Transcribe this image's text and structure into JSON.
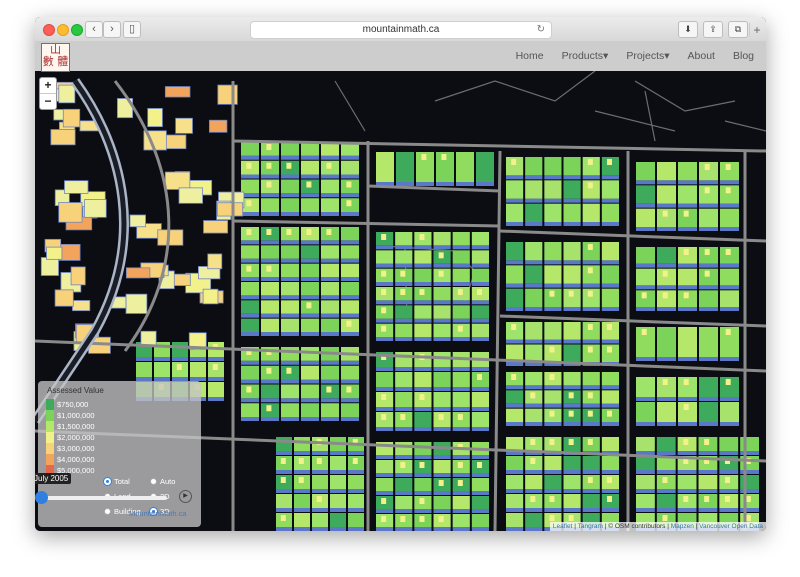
{
  "browser": {
    "url": "mountainmath.ca",
    "nav_back": "‹",
    "nav_forward": "›",
    "sidebar_glyph": "▯",
    "reload_glyph": "↻",
    "download_glyph": "⬇",
    "share_glyph": "⇪",
    "tabs_glyph": "⧉",
    "new_tab_glyph": "+"
  },
  "site": {
    "logo_text": "山數\n數 體",
    "menu": [
      "Home",
      "Products▾",
      "Projects▾",
      "About",
      "Blog"
    ]
  },
  "map_controls": {
    "zoom_in": "+",
    "zoom_out": "−"
  },
  "legend": {
    "title": "Assessed Value",
    "entries": [
      {
        "label": "$750,000",
        "color": "#3daa5c"
      },
      {
        "label": "$1,000,000",
        "color": "#7cd35a"
      },
      {
        "label": "$1,500,000",
        "color": "#b5e86a"
      },
      {
        "label": "$2,000,000",
        "color": "#f3f28a"
      },
      {
        "label": "$3,000,000",
        "color": "#f7d27a"
      },
      {
        "label": "$4,000,000",
        "color": "#f2a35c"
      },
      {
        "label": "$5,000,000",
        "color": "#e8674a"
      }
    ],
    "options": [
      {
        "label": "Total",
        "selected": true
      },
      {
        "label": "Auto",
        "selected": false
      },
      {
        "label": "Land",
        "selected": false
      },
      {
        "label": "2D",
        "selected": false
      },
      {
        "label": "Building",
        "selected": false
      },
      {
        "label": "3D",
        "selected": true
      }
    ],
    "date_label": "July 2005",
    "play_glyph": "▶",
    "brand": "MountainMath.ca"
  },
  "attribution": {
    "leaflet": "Leaflet",
    "tangram": "Tangram",
    "osm": "© OSM contributors",
    "mapzen": "Mapzen",
    "vancouver": "Vancouver Open Data"
  },
  "colors": {
    "background": "#0b0d12",
    "road": "#8a8a8a",
    "side_shade": "#5a78c8"
  }
}
